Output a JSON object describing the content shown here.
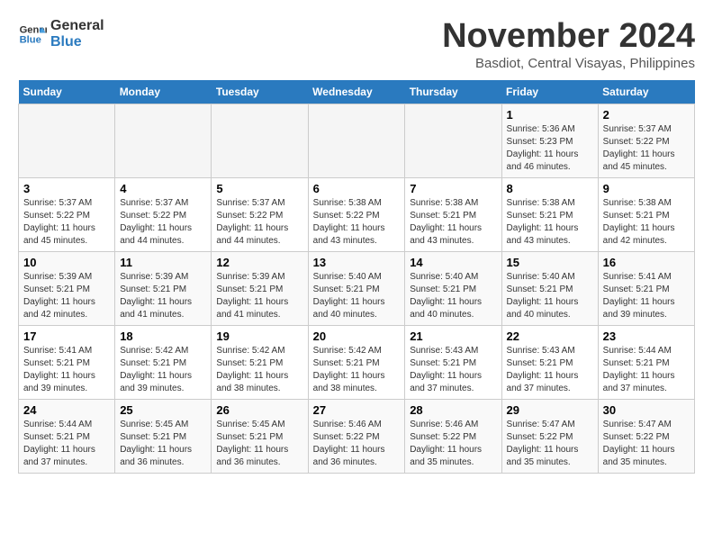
{
  "header": {
    "logo_line1": "General",
    "logo_line2": "Blue",
    "month_title": "November 2024",
    "subtitle": "Basdiot, Central Visayas, Philippines"
  },
  "weekdays": [
    "Sunday",
    "Monday",
    "Tuesday",
    "Wednesday",
    "Thursday",
    "Friday",
    "Saturday"
  ],
  "weeks": [
    [
      {
        "day": "",
        "info": ""
      },
      {
        "day": "",
        "info": ""
      },
      {
        "day": "",
        "info": ""
      },
      {
        "day": "",
        "info": ""
      },
      {
        "day": "",
        "info": ""
      },
      {
        "day": "1",
        "info": "Sunrise: 5:36 AM\nSunset: 5:23 PM\nDaylight: 11 hours and 46 minutes."
      },
      {
        "day": "2",
        "info": "Sunrise: 5:37 AM\nSunset: 5:22 PM\nDaylight: 11 hours and 45 minutes."
      }
    ],
    [
      {
        "day": "3",
        "info": "Sunrise: 5:37 AM\nSunset: 5:22 PM\nDaylight: 11 hours and 45 minutes."
      },
      {
        "day": "4",
        "info": "Sunrise: 5:37 AM\nSunset: 5:22 PM\nDaylight: 11 hours and 44 minutes."
      },
      {
        "day": "5",
        "info": "Sunrise: 5:37 AM\nSunset: 5:22 PM\nDaylight: 11 hours and 44 minutes."
      },
      {
        "day": "6",
        "info": "Sunrise: 5:38 AM\nSunset: 5:22 PM\nDaylight: 11 hours and 43 minutes."
      },
      {
        "day": "7",
        "info": "Sunrise: 5:38 AM\nSunset: 5:21 PM\nDaylight: 11 hours and 43 minutes."
      },
      {
        "day": "8",
        "info": "Sunrise: 5:38 AM\nSunset: 5:21 PM\nDaylight: 11 hours and 43 minutes."
      },
      {
        "day": "9",
        "info": "Sunrise: 5:38 AM\nSunset: 5:21 PM\nDaylight: 11 hours and 42 minutes."
      }
    ],
    [
      {
        "day": "10",
        "info": "Sunrise: 5:39 AM\nSunset: 5:21 PM\nDaylight: 11 hours and 42 minutes."
      },
      {
        "day": "11",
        "info": "Sunrise: 5:39 AM\nSunset: 5:21 PM\nDaylight: 11 hours and 41 minutes."
      },
      {
        "day": "12",
        "info": "Sunrise: 5:39 AM\nSunset: 5:21 PM\nDaylight: 11 hours and 41 minutes."
      },
      {
        "day": "13",
        "info": "Sunrise: 5:40 AM\nSunset: 5:21 PM\nDaylight: 11 hours and 40 minutes."
      },
      {
        "day": "14",
        "info": "Sunrise: 5:40 AM\nSunset: 5:21 PM\nDaylight: 11 hours and 40 minutes."
      },
      {
        "day": "15",
        "info": "Sunrise: 5:40 AM\nSunset: 5:21 PM\nDaylight: 11 hours and 40 minutes."
      },
      {
        "day": "16",
        "info": "Sunrise: 5:41 AM\nSunset: 5:21 PM\nDaylight: 11 hours and 39 minutes."
      }
    ],
    [
      {
        "day": "17",
        "info": "Sunrise: 5:41 AM\nSunset: 5:21 PM\nDaylight: 11 hours and 39 minutes."
      },
      {
        "day": "18",
        "info": "Sunrise: 5:42 AM\nSunset: 5:21 PM\nDaylight: 11 hours and 39 minutes."
      },
      {
        "day": "19",
        "info": "Sunrise: 5:42 AM\nSunset: 5:21 PM\nDaylight: 11 hours and 38 minutes."
      },
      {
        "day": "20",
        "info": "Sunrise: 5:42 AM\nSunset: 5:21 PM\nDaylight: 11 hours and 38 minutes."
      },
      {
        "day": "21",
        "info": "Sunrise: 5:43 AM\nSunset: 5:21 PM\nDaylight: 11 hours and 37 minutes."
      },
      {
        "day": "22",
        "info": "Sunrise: 5:43 AM\nSunset: 5:21 PM\nDaylight: 11 hours and 37 minutes."
      },
      {
        "day": "23",
        "info": "Sunrise: 5:44 AM\nSunset: 5:21 PM\nDaylight: 11 hours and 37 minutes."
      }
    ],
    [
      {
        "day": "24",
        "info": "Sunrise: 5:44 AM\nSunset: 5:21 PM\nDaylight: 11 hours and 37 minutes."
      },
      {
        "day": "25",
        "info": "Sunrise: 5:45 AM\nSunset: 5:21 PM\nDaylight: 11 hours and 36 minutes."
      },
      {
        "day": "26",
        "info": "Sunrise: 5:45 AM\nSunset: 5:21 PM\nDaylight: 11 hours and 36 minutes."
      },
      {
        "day": "27",
        "info": "Sunrise: 5:46 AM\nSunset: 5:22 PM\nDaylight: 11 hours and 36 minutes."
      },
      {
        "day": "28",
        "info": "Sunrise: 5:46 AM\nSunset: 5:22 PM\nDaylight: 11 hours and 35 minutes."
      },
      {
        "day": "29",
        "info": "Sunrise: 5:47 AM\nSunset: 5:22 PM\nDaylight: 11 hours and 35 minutes."
      },
      {
        "day": "30",
        "info": "Sunrise: 5:47 AM\nSunset: 5:22 PM\nDaylight: 11 hours and 35 minutes."
      }
    ]
  ]
}
